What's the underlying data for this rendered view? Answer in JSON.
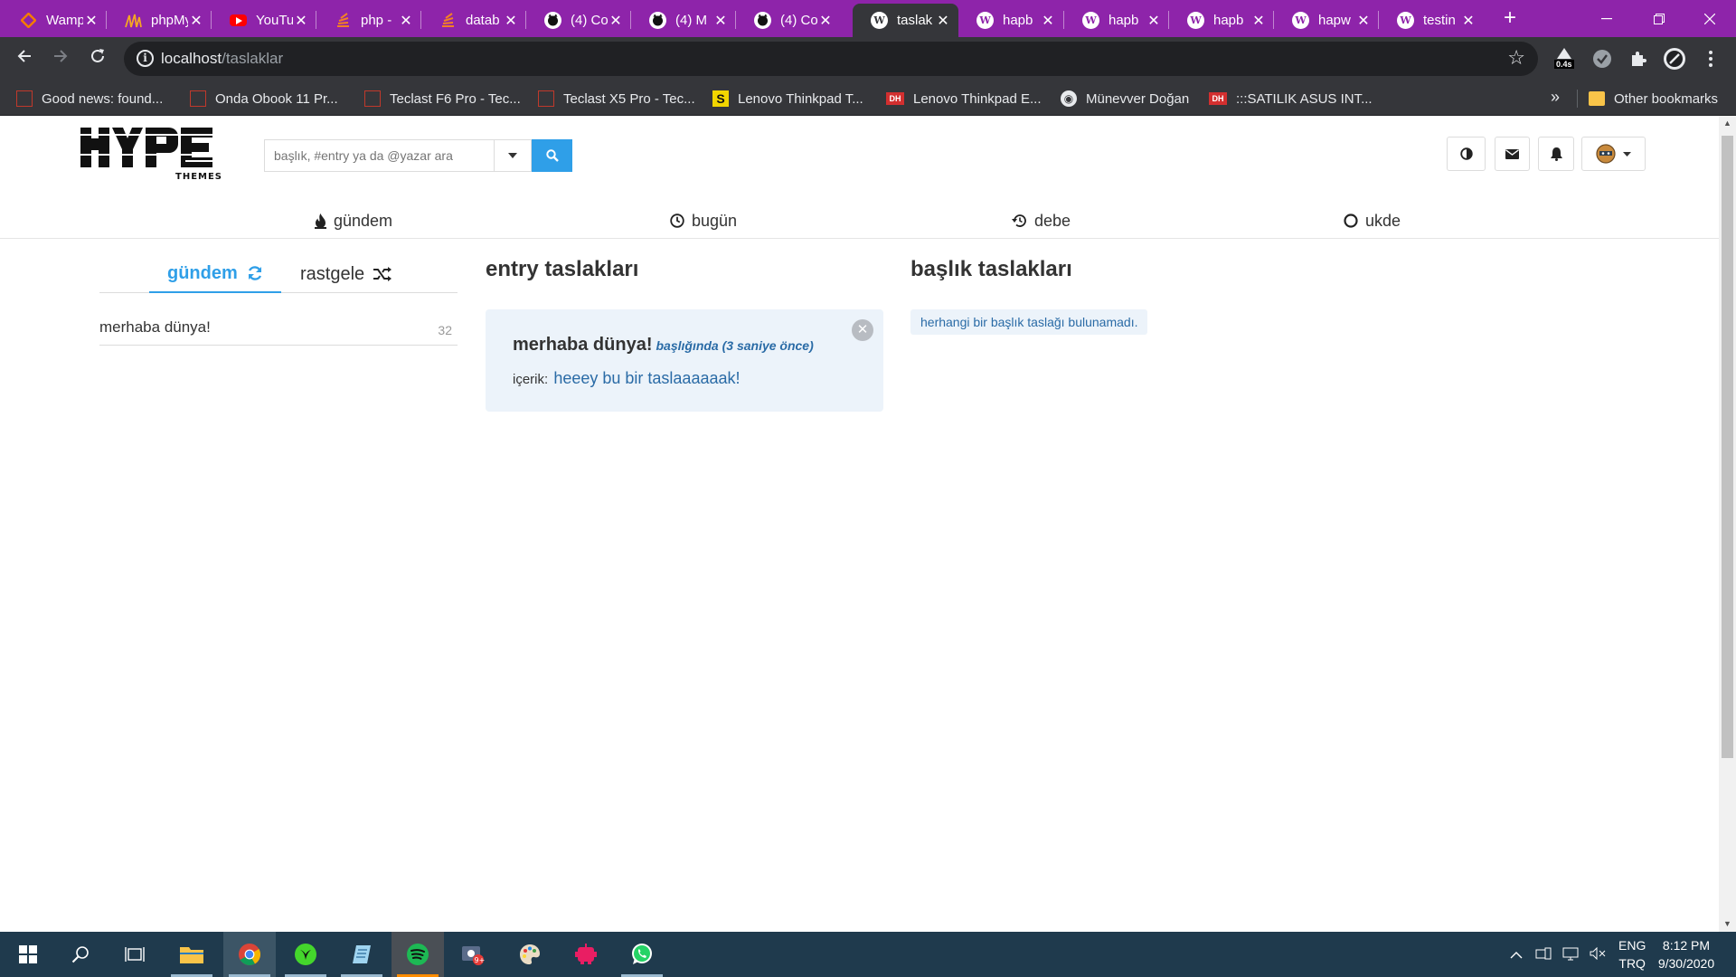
{
  "browser": {
    "tabs": [
      {
        "title": "Wamp",
        "icon": "wamp-icon"
      },
      {
        "title": "phpMy",
        "icon": "phpmyadmin-icon"
      },
      {
        "title": "YouTu",
        "icon": "youtube-icon"
      },
      {
        "title": "php -",
        "icon": "stack-icon"
      },
      {
        "title": "datab",
        "icon": "stack-icon"
      },
      {
        "title": "(4) Co",
        "icon": "github-icon"
      },
      {
        "title": "(4) M",
        "icon": "github-icon"
      },
      {
        "title": "(4) Co",
        "icon": "github-icon"
      },
      {
        "title": "taslak",
        "icon": "wordpress-icon",
        "active": true
      },
      {
        "title": "hapb",
        "icon": "wordpress-icon"
      },
      {
        "title": "hapb",
        "icon": "wordpress-icon"
      },
      {
        "title": "hapb",
        "icon": "wordpress-icon"
      },
      {
        "title": "hapw",
        "icon": "wordpress-icon"
      },
      {
        "title": "testin",
        "icon": "wordpress-icon"
      }
    ],
    "url_host": "localhost",
    "url_path": "/taslaklar",
    "extension_badge": "0.4s",
    "bookmarks": [
      {
        "label": "Good news: found...",
        "icon": "tec"
      },
      {
        "label": "Onda Obook 11 Pr...",
        "icon": "tec"
      },
      {
        "label": "Teclast F6 Pro - Tec...",
        "icon": "tec"
      },
      {
        "label": "Teclast X5 Pro - Tec...",
        "icon": "tec"
      },
      {
        "label": "Lenovo Thinkpad T...",
        "icon": "s"
      },
      {
        "label": "Lenovo Thinkpad E...",
        "icon": "dh"
      },
      {
        "label": "Münevver Doğan",
        "icon": "globe"
      },
      {
        "label": ":::SATILIK ASUS INT...",
        "icon": "dh"
      }
    ],
    "bookmark_s_glyph": "S",
    "bookmark_dh_glyph": "DH",
    "other_bookmarks": "Other bookmarks",
    "more": "»"
  },
  "site": {
    "search_placeholder": "başlık, #entry ya da @yazar ara",
    "nav": [
      {
        "label": "gündem",
        "icon": "fire-icon"
      },
      {
        "label": "bugün",
        "icon": "clock-icon"
      },
      {
        "label": "debe",
        "icon": "history-icon"
      },
      {
        "label": "ukde",
        "icon": "circle-icon"
      }
    ],
    "left_tabs": {
      "gundem": "gündem",
      "rastgele": "rastgele"
    },
    "left_list": [
      {
        "title": "merhaba dünya!",
        "count": "32"
      }
    ],
    "entry_heading": "entry taslakları",
    "title_heading": "başlık taslakları",
    "draft": {
      "title": "merhaba dünya!",
      "meta": "başlığında (3 saniye önce)",
      "content_label": "içerik:",
      "content": "heeey bu bir taslaaaaaak!"
    },
    "no_title_drafts": "herhangi bir başlık taslağı bulunamadı.",
    "accent": "#2f9fe8"
  },
  "taskbar": {
    "lang_line1": "ENG",
    "lang_line2": "TRQ",
    "time": "8:12 PM",
    "date": "9/30/2020"
  }
}
